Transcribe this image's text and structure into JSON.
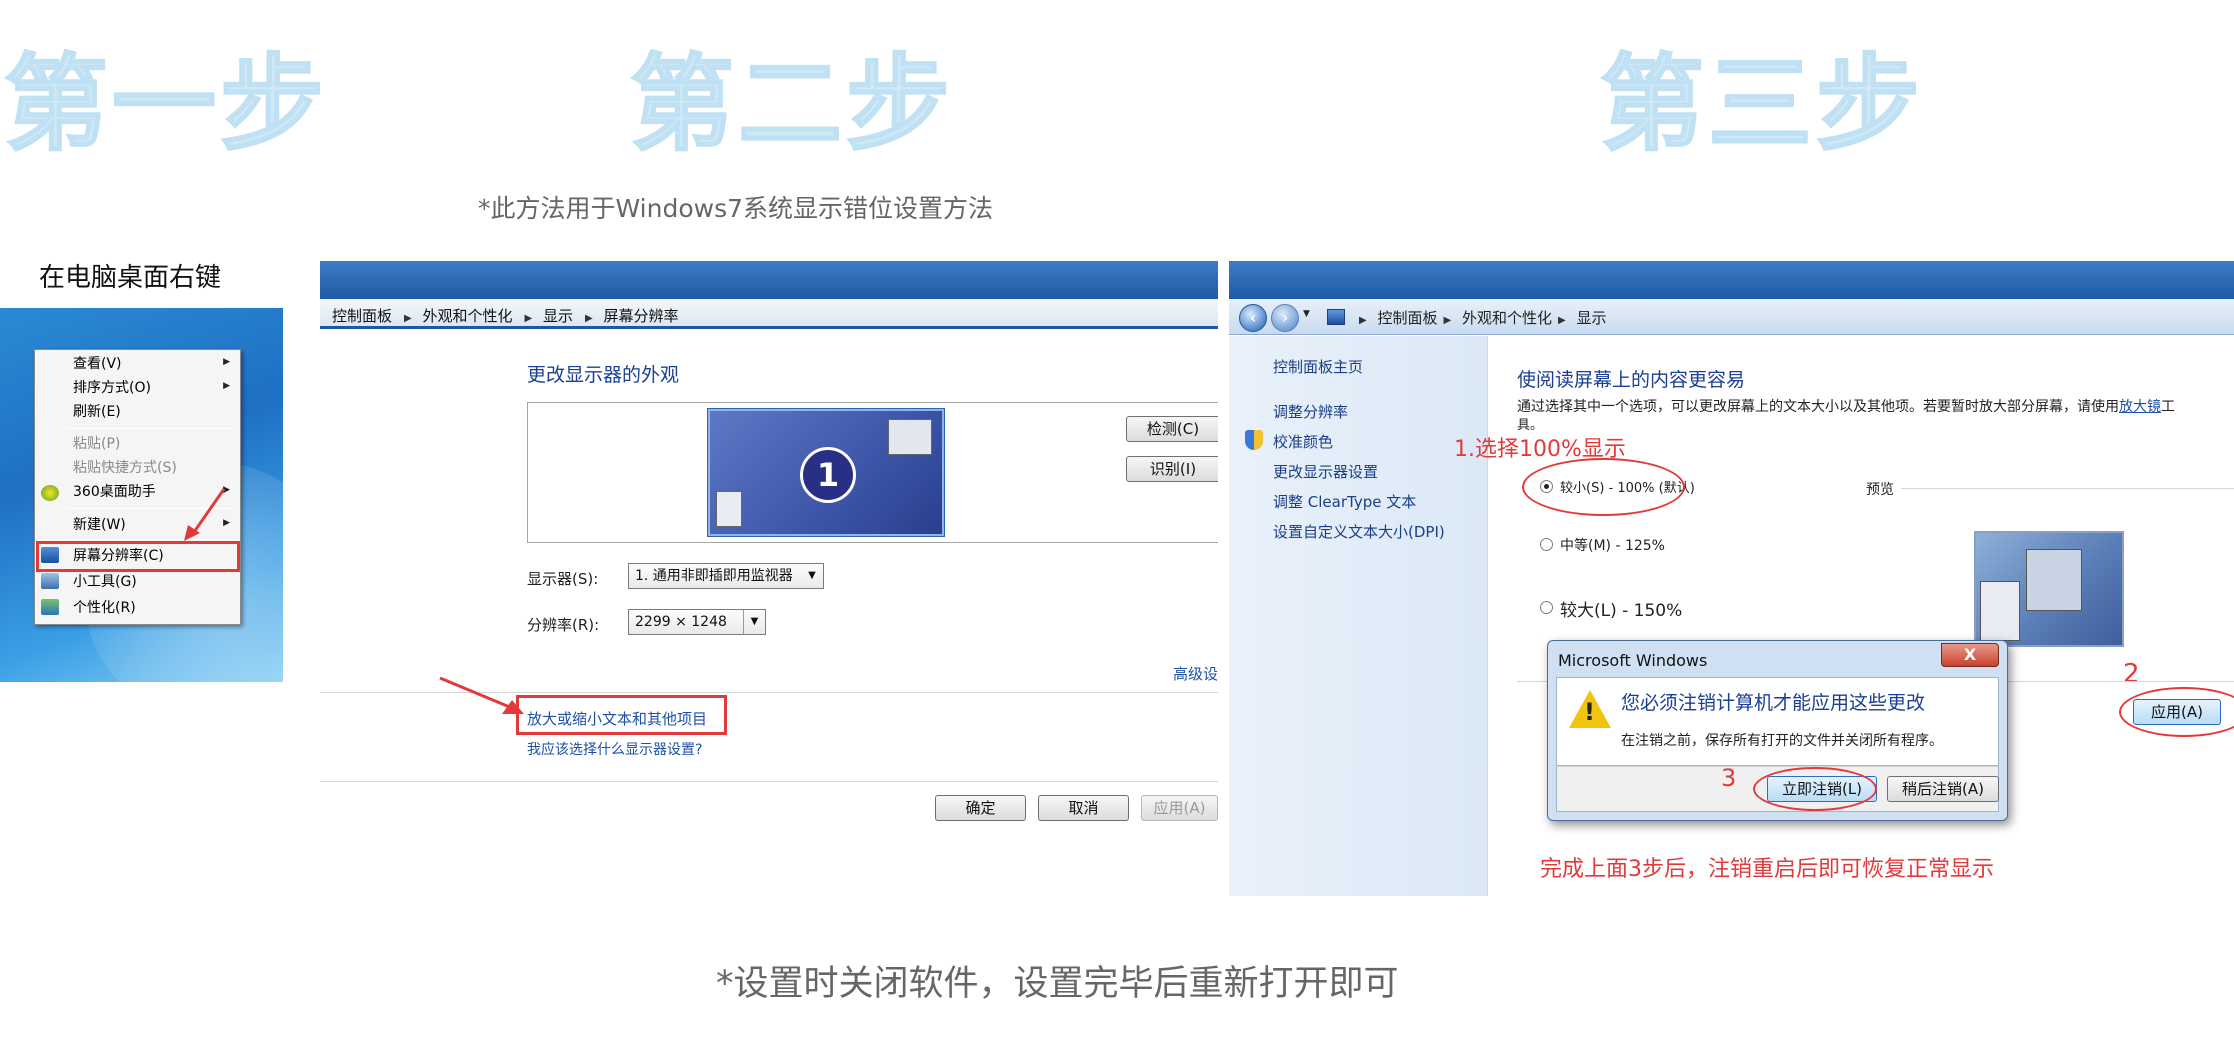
{
  "steps": {
    "step1": "第一步",
    "step2": "第二步",
    "step3": "第三步"
  },
  "notes": {
    "top": "*此方法用于Windows7系统显示错位设置方法",
    "bottom": "*设置时关闭软件，设置完毕后重新打开即可"
  },
  "panel1": {
    "label": "在电脑桌面右键",
    "menu": [
      {
        "label": "查看(V)",
        "submenu": true,
        "disabled": false
      },
      {
        "label": "排序方式(O)",
        "submenu": true,
        "disabled": false
      },
      {
        "label": "刷新(E)",
        "submenu": false,
        "disabled": false
      },
      {
        "label": "粘贴(P)",
        "submenu": false,
        "disabled": true
      },
      {
        "label": "粘贴快捷方式(S)",
        "submenu": false,
        "disabled": true
      },
      {
        "label": "360桌面助手",
        "submenu": true,
        "disabled": false
      },
      {
        "label": "新建(W)",
        "submenu": true,
        "disabled": false
      },
      {
        "label": "屏幕分辨率(C)",
        "submenu": false,
        "disabled": false
      },
      {
        "label": "小工具(G)",
        "submenu": false,
        "disabled": false
      },
      {
        "label": "个性化(R)",
        "submenu": false,
        "disabled": false
      }
    ]
  },
  "panel2": {
    "breadcrumbs": [
      "控制面板",
      "外观和个性化",
      "显示",
      "屏幕分辨率"
    ],
    "title": "更改显示器的外观",
    "monitor_number": "1",
    "detect_button": "检测(C)",
    "identify_button": "识别(I)",
    "display_label": "显示器(S):",
    "display_value": "1. 通用非即插即用监视器",
    "resolution_label": "分辨率(R):",
    "resolution_value": "2299 × 1248",
    "advanced_link": "高级设",
    "link_text_size": "放大或缩小文本和其他项目",
    "link_which_settings": "我应该选择什么显示器设置?",
    "ok_button": "确定",
    "cancel_button": "取消",
    "apply_button": "应用(A)"
  },
  "panel3": {
    "breadcrumbs": [
      "控制面板",
      "外观和个性化",
      "显示"
    ],
    "sidebar": [
      "控制面板主页",
      "调整分辨率",
      "校准颜色",
      "更改显示器设置",
      "调整 ClearType 文本",
      "设置自定义文本大小(DPI)"
    ],
    "title": "使阅读屏幕上的内容更容易",
    "desc": "通过选择其中一个选项，可以更改屏幕上的文本大小以及其他项。若要暂时放大部分屏幕，请使用",
    "desc_link": "放大镜",
    "desc_end": "工",
    "desc_wrap": "具。",
    "annotation_1": "1.选择100%显示",
    "options": [
      "较小(S) - 100% (默认)",
      "中等(M) - 125%",
      "较大(L) - 150%"
    ],
    "preview_label": "预览",
    "annotation_2": "2",
    "apply_button": "应用(A)",
    "dialog": {
      "title": "Microsoft Windows",
      "close": "X",
      "heading": "您必须注销计算机才能应用这些更改",
      "message": "在注销之前，保存所有打开的文件并关闭所有程序。",
      "annotation_3": "3",
      "logoff_now": "立即注销(L)",
      "logoff_later": "稍后注销(A)"
    },
    "final_note": "完成上面3步后，注销重启后即可恢复正常显示"
  },
  "colors": {
    "step_title": "#cfe9f7",
    "annotation_red": "#e23a3a",
    "link_blue": "#1e4fa6",
    "heading_blue": "#1a3f94"
  }
}
